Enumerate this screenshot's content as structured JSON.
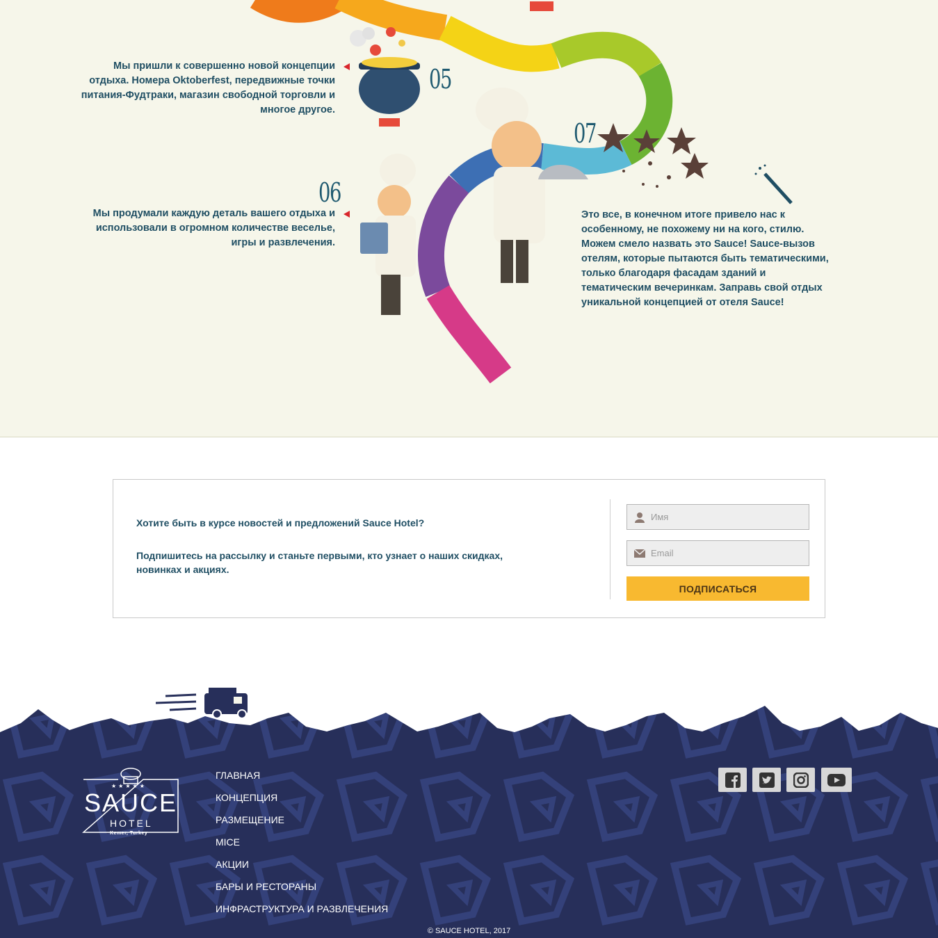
{
  "concept": {
    "steps": [
      {
        "number": "05",
        "text": "Мы пришли к совершенно новой концепции отдыха. Номера Oktoberfest, передвижные точки питания-Фудтраки, магазин свободной торговли и многое другое."
      },
      {
        "number": "06",
        "text": "Мы продумали каждую деталь вашего отдыха и использовали в огромном количестве веселье, игры и развлечения."
      },
      {
        "number": "07",
        "text": "Это все, в конечном итоге привело нас к особенному, не похожему ни на кого, стилю. Можем смело назвать это Sauce! Sauce-вызов отелям, которые пытаются быть тематическими, только благодаря фасадам зданий и тематическим вечеринкам. Заправь свой отдых уникальной концепцией от отеля Sauce!"
      }
    ]
  },
  "subscribe": {
    "heading": "Хотите быть в курсе новостей и предложений Sauce Hotel?",
    "text": "Подпишитесь на рассылку и станьте первыми, кто узнает о наших скидках, новинках и акциях.",
    "name_placeholder": "Имя",
    "email_placeholder": "Email",
    "button_label": "ПОДПИСАТЬСЯ"
  },
  "footer": {
    "logo": {
      "stars": "★★★★★",
      "name": "SAUCE",
      "sub": "HOTEL",
      "location": "Kemer, Turkey"
    },
    "nav": [
      "ГЛАВНАЯ",
      "КОНЦЕПЦИЯ",
      "РАЗМЕЩЕНИЕ",
      "MICE",
      "АКЦИИ",
      "БАРЫ И РЕСТОРАНЫ",
      "ИНФРАСТРУКТУРА И РАЗВЛЕЧЕНИЯ"
    ],
    "social": [
      "facebook-icon",
      "twitter-icon",
      "instagram-icon",
      "youtube-icon"
    ],
    "copyright": "© SAUCE HOTEL, 2017"
  },
  "colors": {
    "road": [
      "#ef7b1b",
      "#f6a81c",
      "#f4d316",
      "#e4dc18",
      "#a8c92a",
      "#6cb332",
      "#5cbad6",
      "#3d6fb4",
      "#7b4a9c",
      "#d63a88"
    ],
    "footer_bg": "#272f5a",
    "button": "#f8b930",
    "text": "#1f4e63"
  }
}
